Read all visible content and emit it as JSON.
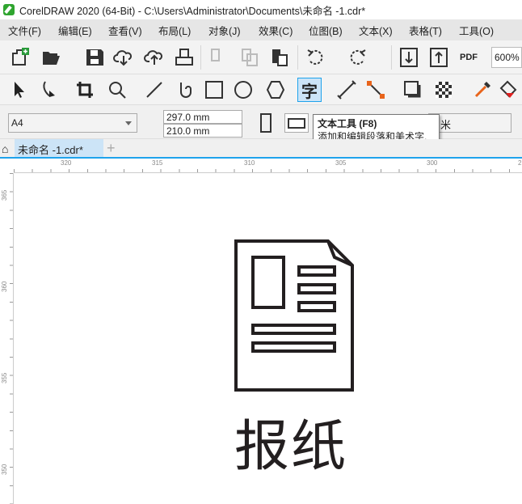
{
  "window": {
    "title": "CorelDRAW 2020 (64-Bit) - C:\\Users\\Administrator\\Documents\\未命名 -1.cdr*"
  },
  "menu": [
    "文件(F)",
    "编辑(E)",
    "查看(V)",
    "布局(L)",
    "对象(J)",
    "效果(C)",
    "位图(B)",
    "文本(X)",
    "表格(T)",
    "工具(O)"
  ],
  "toolbar": {
    "zoom": "600%",
    "pdf_label": "PDF"
  },
  "property_bar": {
    "page_size": "A4",
    "width": "297.0 mm",
    "height": "210.0 mm",
    "units": "米"
  },
  "tooltip": {
    "title": "文本工具 (F8)",
    "description": "添加和编辑段落和美术字."
  },
  "tabs": {
    "document": "未命名 -1.cdr*"
  },
  "rulers": {
    "horizontal": [
      "320",
      "315",
      "310",
      "305",
      "300",
      "2"
    ],
    "vertical": [
      "365",
      "360",
      "355",
      "350"
    ]
  },
  "canvas": {
    "text": "报纸"
  },
  "colors": {
    "menu_bg": "#e6e6e6",
    "accent": "#1fa3ec",
    "tab_active": "#cce4f7"
  }
}
